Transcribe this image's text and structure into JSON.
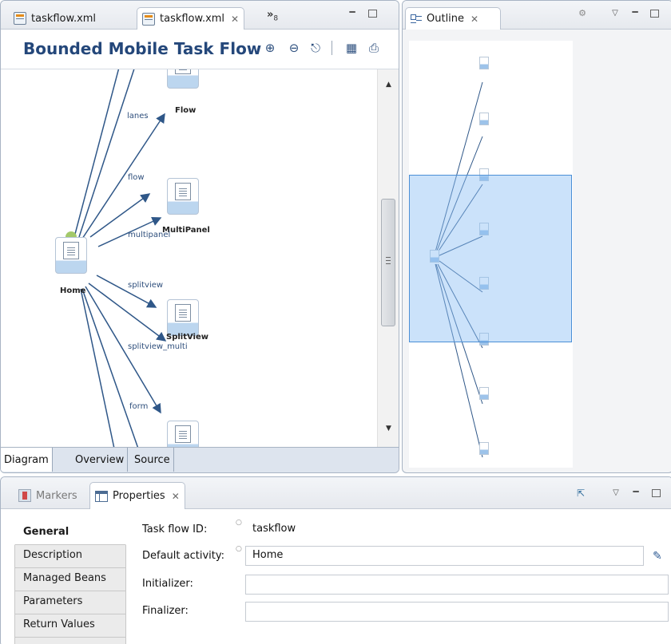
{
  "editor": {
    "tabs": [
      {
        "label": "taskflow.xml"
      },
      {
        "label": "taskflow.xml",
        "close": "✕"
      }
    ],
    "overflow": {
      "label": "»",
      "count": "8"
    },
    "title": "Bounded Mobile Task Flow",
    "nodes": [
      {
        "label": "Flow"
      },
      {
        "label": "MultiPanel"
      },
      {
        "label": "Home"
      },
      {
        "label": "SplitView"
      }
    ],
    "edges": [
      "lanes",
      "flow",
      "multipanel",
      "splitview",
      "splitview_multi",
      "form"
    ],
    "bottom_tabs": [
      "Diagram",
      "Overview",
      "Source"
    ]
  },
  "outline": {
    "title": "Outline",
    "close": "✕"
  },
  "properties": {
    "tabs": [
      {
        "label": "Markers"
      },
      {
        "label": "Properties",
        "close": "✕"
      }
    ],
    "side_tabs": [
      "General",
      "Description",
      "Managed Beans",
      "Parameters",
      "Return Values"
    ],
    "fields": {
      "task_flow_id": {
        "label": "Task flow ID:",
        "value": "taskflow"
      },
      "default_activity": {
        "label": "Default activity:",
        "value": "Home"
      },
      "initializer": {
        "label": "Initializer:",
        "value": ""
      },
      "finalizer": {
        "label": "Finalizer:",
        "value": ""
      }
    }
  }
}
